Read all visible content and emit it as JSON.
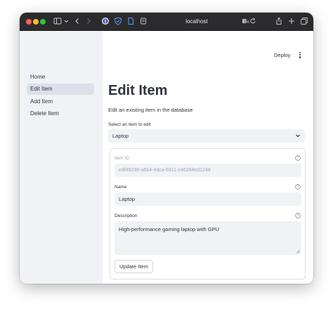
{
  "browser": {
    "url": "localhost"
  },
  "sidebar": {
    "items": [
      {
        "label": "Home",
        "active": false
      },
      {
        "label": "Edit Item",
        "active": true
      },
      {
        "label": "Add Item",
        "active": false
      },
      {
        "label": "Delete Item",
        "active": false
      }
    ]
  },
  "header": {
    "deploy_label": "Deploy"
  },
  "main": {
    "title": "Edit Item",
    "subtitle": "Edit an existing item in the database",
    "select_label": "Select an item to edit",
    "select_value": "Laptop",
    "form": {
      "id_label": "Item ID",
      "id_value": "edf49238-a6b4-4dca-9311-c46394ed1248",
      "name_label": "Name",
      "name_value": "Laptop",
      "description_label": "Description",
      "description_value": "High-performance gaming laptop with GPU",
      "submit_label": "Update Item"
    }
  },
  "colors": {
    "sidebar_bg": "#f0f2f6",
    "input_bg": "#f0f2f6",
    "text": "#31333f"
  }
}
